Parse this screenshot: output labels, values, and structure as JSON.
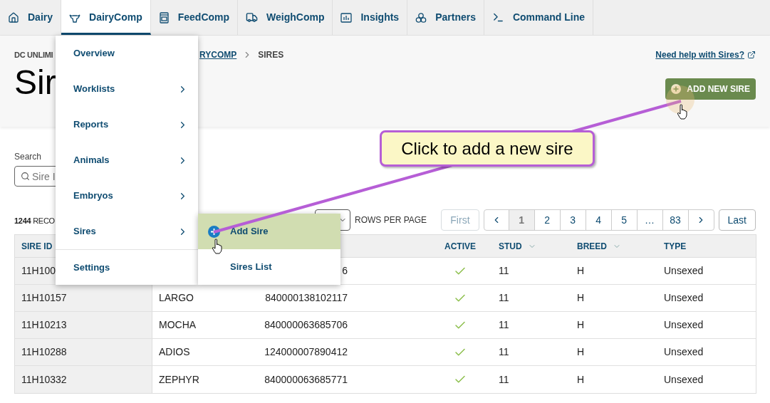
{
  "nav_tabs": [
    {
      "label": "Dairy",
      "selected": false
    },
    {
      "label": "DairyComp",
      "selected": true
    },
    {
      "label": "FeedComp",
      "selected": false
    },
    {
      "label": "WeighComp",
      "selected": false
    },
    {
      "label": "Insights",
      "selected": false
    },
    {
      "label": "Partners",
      "selected": false
    },
    {
      "label": "Command Line",
      "selected": false
    }
  ],
  "breadcrumb": {
    "first": "DC UNLIMI",
    "link": "RYCOMP",
    "current": "SIRES"
  },
  "title": "Sir",
  "help_link": "Need help with Sires?",
  "add_button": "ADD NEW SIRE",
  "search": {
    "label": "Search",
    "placeholder": "Sire I"
  },
  "records": {
    "count": "1244",
    "label": "RECO"
  },
  "rows_per_page_label": "ROWS PER PAGE",
  "pagination": {
    "first": {
      "label": "First",
      "disabled": true
    },
    "pages": [
      {
        "label": "1",
        "selected": true
      },
      {
        "label": "2",
        "selected": false
      },
      {
        "label": "3",
        "selected": false
      },
      {
        "label": "4",
        "selected": false
      },
      {
        "label": "5",
        "selected": false
      },
      {
        "label": "…",
        "selected": false
      },
      {
        "label": "83",
        "selected": false
      }
    ],
    "last": {
      "label": "Last",
      "disabled": false
    }
  },
  "table": {
    "columns": {
      "sire_id": {
        "label": "SIRE ID",
        "sortable": false
      },
      "active": {
        "label": "ACTIVE",
        "sortable": false
      },
      "stud": {
        "label": "STUD",
        "sortable": true
      },
      "breed": {
        "label": "BREED",
        "sortable": true
      },
      "type": {
        "label": "TYPE",
        "sortable": false
      }
    },
    "rows": [
      {
        "sire_id": "11H100",
        "number": "6",
        "active": true,
        "stud": "11",
        "breed": "H",
        "type": "Unsexed"
      },
      {
        "sire_id": "11H10157",
        "name": "LARGO",
        "number": "840000138102117",
        "active": true,
        "stud": "11",
        "breed": "H",
        "type": "Unsexed"
      },
      {
        "sire_id": "11H10213",
        "name": "MOCHA",
        "number": "840000063685706",
        "active": true,
        "stud": "11",
        "breed": "H",
        "type": "Unsexed"
      },
      {
        "sire_id": "11H10288",
        "name": "ADIOS",
        "number": "124000007890412",
        "active": true,
        "stud": "11",
        "breed": "H",
        "type": "Unsexed"
      },
      {
        "sire_id": "11H10332",
        "name": "ZEPHYR",
        "number": "840000063685771",
        "active": true,
        "stud": "11",
        "breed": "H",
        "type": "Unsexed"
      }
    ]
  },
  "menu": {
    "items": [
      {
        "label": "Overview",
        "has_submenu": false
      },
      {
        "label": "Worklists",
        "has_submenu": true
      },
      {
        "label": "Reports",
        "has_submenu": true
      },
      {
        "label": "Animals",
        "has_submenu": true
      },
      {
        "label": "Embryos",
        "has_submenu": true
      },
      {
        "label": "Sires",
        "has_submenu": true
      },
      {
        "label": "Settings",
        "has_submenu": false
      }
    ],
    "submenu": [
      {
        "label": "Add Sire",
        "selected": true
      },
      {
        "label": "Sires List",
        "selected": false
      }
    ]
  },
  "callout": "Click to add a new sire"
}
